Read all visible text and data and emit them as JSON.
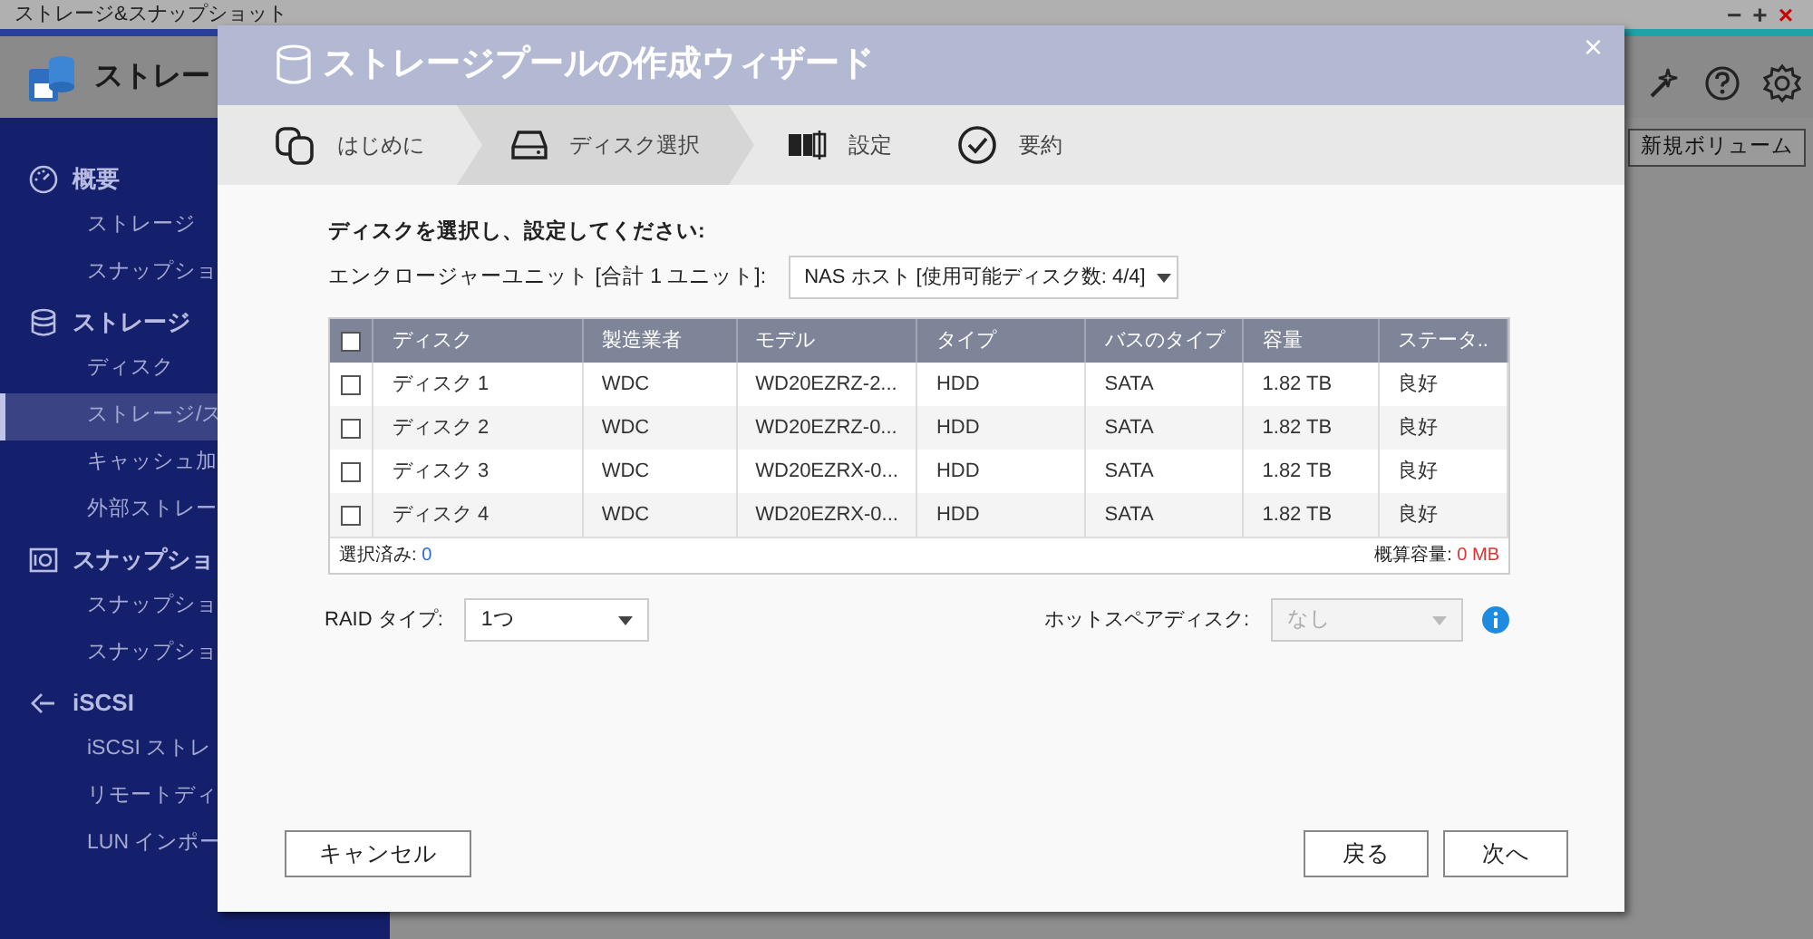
{
  "app": {
    "title": "ストレージ&スナップショット",
    "window_controls": [
      "−",
      "+",
      "×"
    ],
    "header_title": "ストレー",
    "new_volume_button": "新規ボリューム"
  },
  "sidebar": {
    "sections": [
      {
        "label": "概要",
        "children": [
          {
            "label": "ストレージ",
            "selected": false
          },
          {
            "label": "スナップショ",
            "selected": false
          }
        ]
      },
      {
        "label": "ストレージ",
        "children": [
          {
            "label": "ディスク",
            "selected": false
          },
          {
            "label": "ストレージ/ス",
            "selected": true
          },
          {
            "label": "キャッシュ加",
            "selected": false
          },
          {
            "label": "外部ストレー",
            "selected": false
          }
        ]
      },
      {
        "label": "スナップショ",
        "children": [
          {
            "label": "スナップショ",
            "selected": false
          },
          {
            "label": "スナップショ",
            "selected": false
          }
        ]
      },
      {
        "label": "iSCSI",
        "children": [
          {
            "label": "iSCSI ストレ",
            "selected": false
          },
          {
            "label": "リモートディ",
            "selected": false
          },
          {
            "label": "LUN インポー",
            "selected": false
          }
        ]
      }
    ]
  },
  "wizard": {
    "title": "ストレージプールの作成ウィザード",
    "close": "×",
    "steps": [
      {
        "label": "はじめに",
        "selected": false
      },
      {
        "label": "ディスク選択",
        "selected": true
      },
      {
        "label": "設定",
        "selected": false
      },
      {
        "label": "要約",
        "selected": false
      }
    ],
    "instruction": "ディスクを選択し、設定してください:",
    "enclosure_label": "エンクロージャーユニット [合計 1 ユニット]:",
    "enclosure_value": "NAS ホスト [使用可能ディスク数: 4/4]",
    "table": {
      "select_all_checked": false,
      "columns": [
        "ディスク",
        "製造業者",
        "モデル",
        "タイプ",
        "バスのタイプ",
        "容量",
        "ステータ.."
      ],
      "rows": [
        {
          "checked": false,
          "cells": [
            "ディスク 1",
            "WDC",
            "WD20EZRZ-2...",
            "HDD",
            "SATA",
            "1.82 TB",
            "良好"
          ]
        },
        {
          "checked": false,
          "cells": [
            "ディスク 2",
            "WDC",
            "WD20EZRZ-0...",
            "HDD",
            "SATA",
            "1.82 TB",
            "良好"
          ]
        },
        {
          "checked": false,
          "cells": [
            "ディスク 3",
            "WDC",
            "WD20EZRX-0...",
            "HDD",
            "SATA",
            "1.82 TB",
            "良好"
          ]
        },
        {
          "checked": false,
          "cells": [
            "ディスク 4",
            "WDC",
            "WD20EZRX-0...",
            "HDD",
            "SATA",
            "1.82 TB",
            "良好"
          ]
        }
      ],
      "selected_label": "選択済み:",
      "selected_value": "0",
      "capacity_label": "概算容量:",
      "capacity_value": "0 MB"
    },
    "raid_label": "RAID タイプ:",
    "raid_value": "1つ",
    "hot_spare_label": "ホットスペアディスク:",
    "hot_spare_value": "なし",
    "hot_spare_disabled": true,
    "buttons": {
      "cancel": "キャンセル",
      "back": "戻る",
      "next": "次へ"
    }
  }
}
